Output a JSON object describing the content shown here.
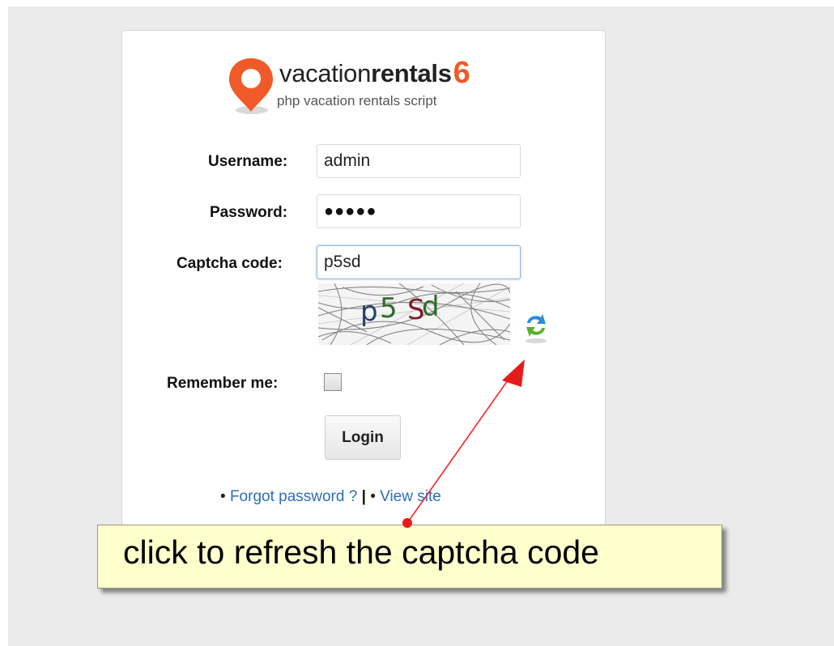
{
  "logo": {
    "brand_regular": "vacation",
    "brand_bold": "rentals",
    "brand_number": "6",
    "tagline": "php vacation rentals script",
    "pin_color": "#f05a28"
  },
  "form": {
    "username_label": "Username:",
    "username_value": "admin",
    "password_label": "Password:",
    "password_value": "●●●●●",
    "captcha_label": "Captcha code:",
    "captcha_value": "p5sd",
    "captcha_image_text": "p5 Sd",
    "remember_label": "Remember me:",
    "remember_checked": false,
    "login_button_label": "Login"
  },
  "links": {
    "bullet1": "•",
    "forgot_password": "Forgot password ?",
    "separator": "|",
    "bullet2": "•",
    "view_site": "View site",
    "link_color": "#2a6fb8"
  },
  "annotation": {
    "callout_text": "click to refresh the captcha code",
    "arrow_color": "#ff0000",
    "callout_bg": "#ffffcc"
  },
  "icons": {
    "refresh": "refresh-icon",
    "location_pin": "location-pin-icon"
  }
}
